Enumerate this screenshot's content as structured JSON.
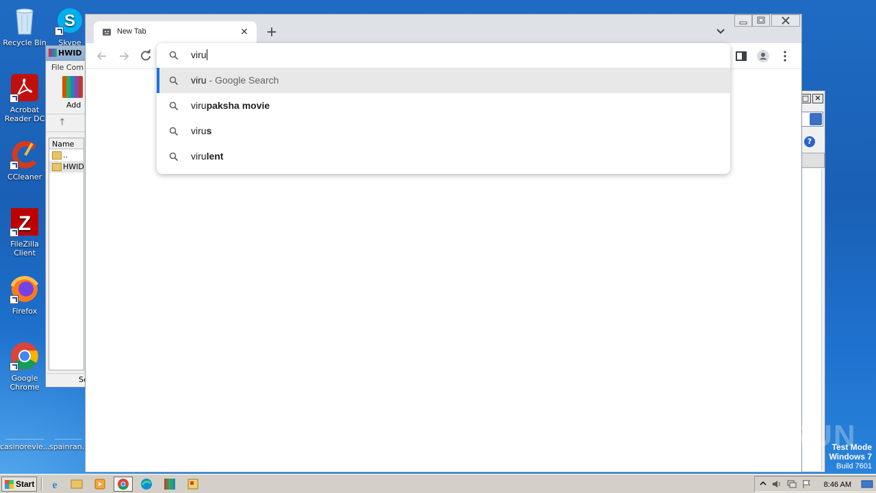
{
  "desktop": {
    "icons": [
      {
        "label": "Recycle Bin"
      },
      {
        "label": "Skype"
      },
      {
        "label": "Acrobat Reader DC"
      },
      {
        "label": "CCleaner"
      },
      {
        "label": "FileZilla Client"
      },
      {
        "label": "Firefox"
      },
      {
        "label": "Google Chrome"
      },
      {
        "label": "casinorevie..."
      },
      {
        "label": "spainran..."
      }
    ]
  },
  "winrar": {
    "title": "HWID",
    "menu": "File  Com",
    "add_label": "Add",
    "col_name": "Name",
    "rows": [
      "..",
      "HWID"
    ],
    "status": "Se"
  },
  "chrome": {
    "tab_title": "New Tab",
    "new_tab": "+",
    "tab_close": "✕",
    "omnibox": {
      "input_value": "viru",
      "suggestions": [
        {
          "typed": "viru",
          "rest": "",
          "suffix": " - Google Search"
        },
        {
          "typed": "viru",
          "rest": "paksha movie",
          "suffix": ""
        },
        {
          "typed": "viru",
          "rest": "s",
          "suffix": ""
        },
        {
          "typed": "viru",
          "rest": "lent",
          "suffix": ""
        }
      ]
    }
  },
  "overlay": {
    "watermark": "ANY RUN",
    "test_mode_line1": "Test Mode",
    "test_mode_line2": "Windows 7",
    "test_mode_line3": "Build 7601"
  },
  "taskbar": {
    "start_label": "Start",
    "clock": "8:46 AM"
  },
  "colors": {
    "accent": "#1a73e8",
    "tabstrip": "#dee1e6",
    "desktop": "#1f6bc4"
  }
}
